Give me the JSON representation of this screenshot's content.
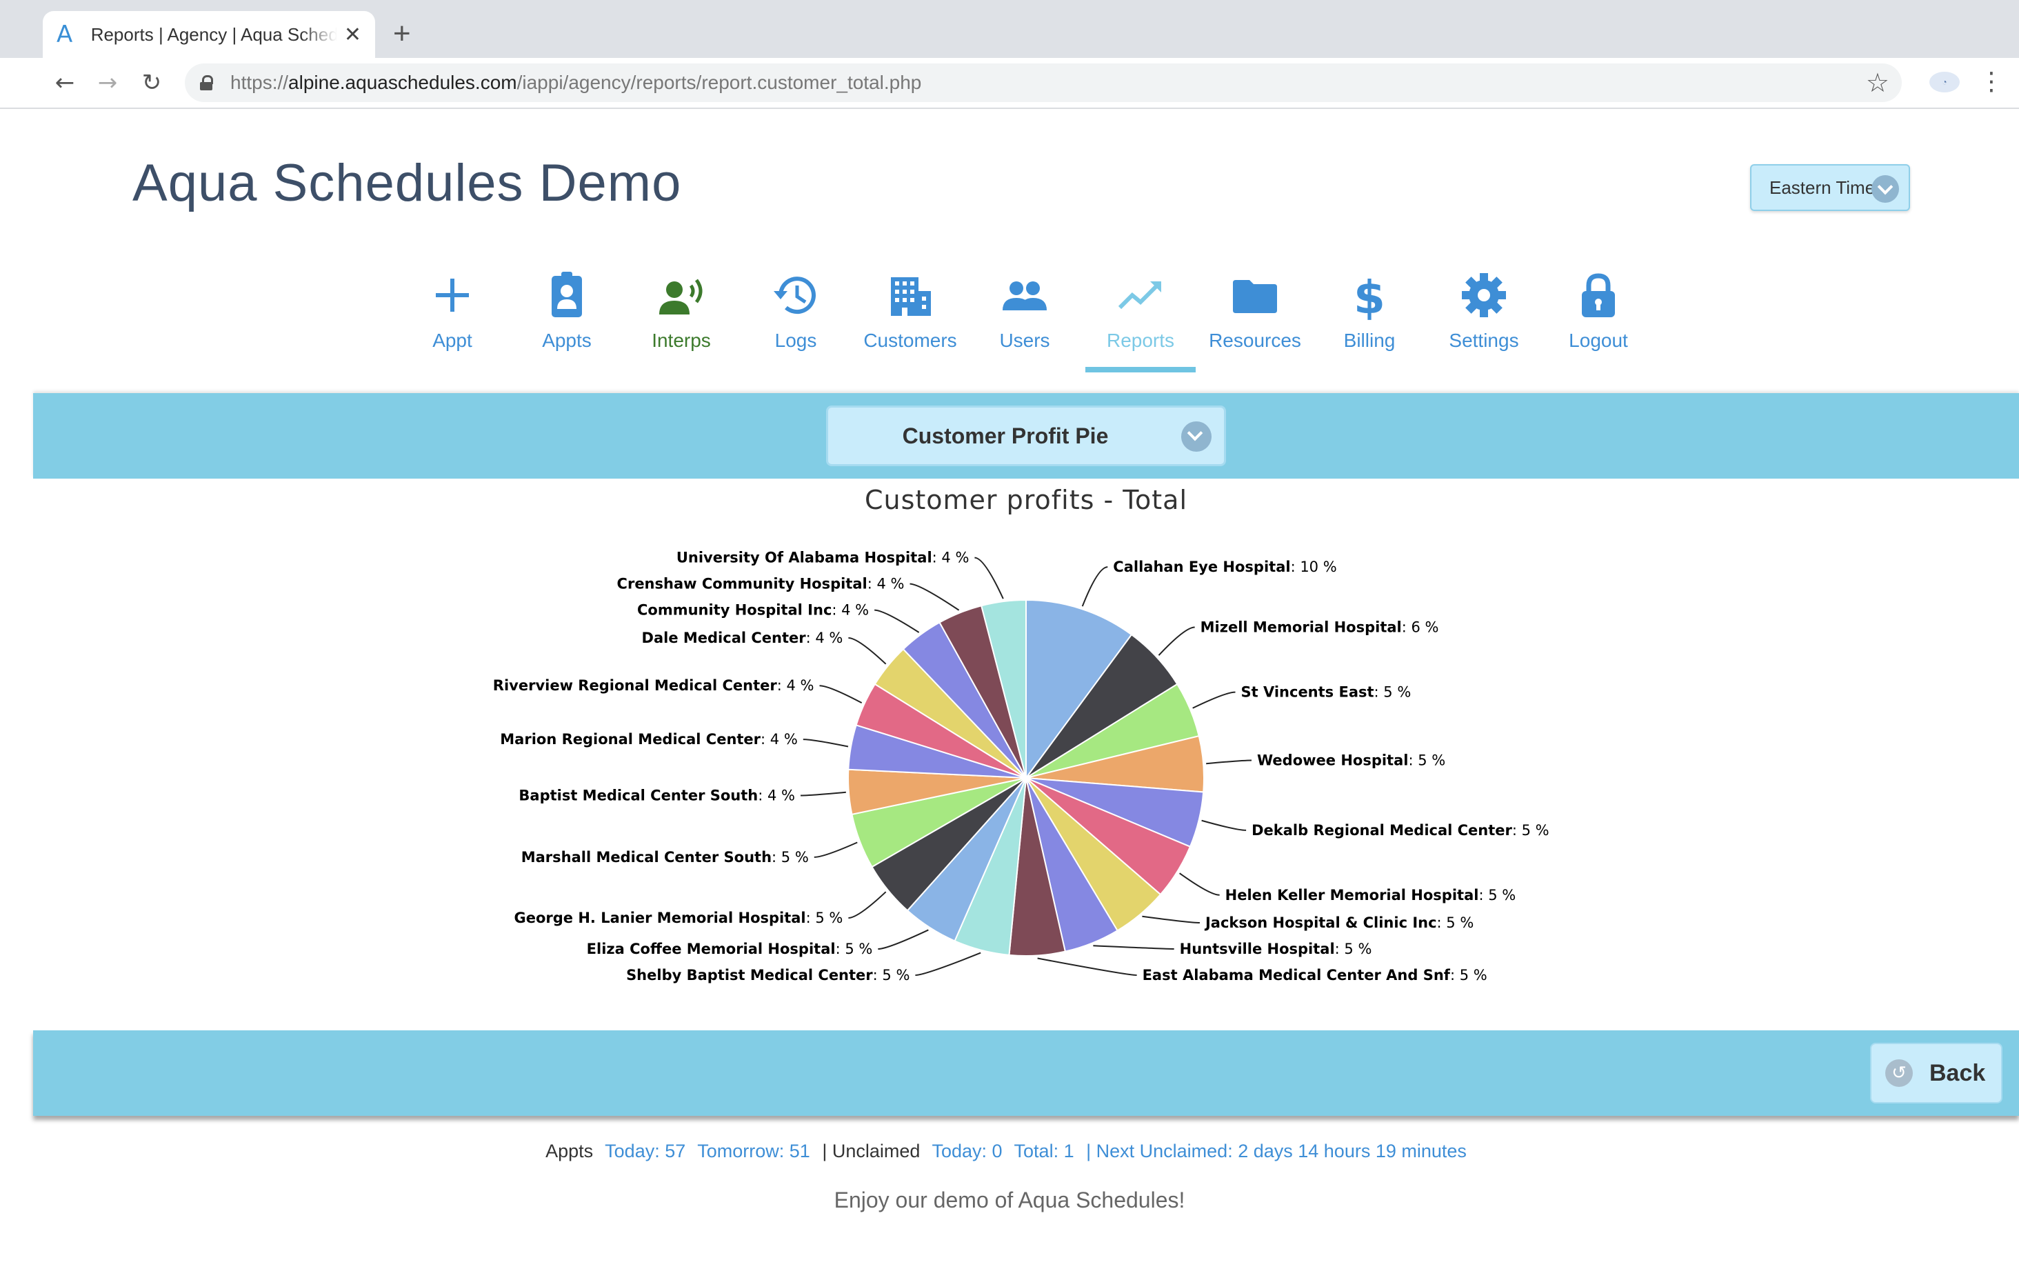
{
  "browser": {
    "tab_title": "Reports | Agency | Aqua Schedules",
    "tab_favicon": "A",
    "url_prefix": "https://",
    "url_host": "alpine.aquaschedules.com",
    "url_path": "/iappi/agency/reports/report.customer_total.php",
    "icons": [
      "back-arrow-icon",
      "forward-arrow-icon",
      "reload-icon",
      "lock-icon",
      "star-icon",
      "extension-icon",
      "menu-icon"
    ]
  },
  "header": {
    "title": "Aqua Schedules Demo",
    "timezone": "Eastern Time"
  },
  "nav": [
    {
      "label": "Appt",
      "icon": "plus-icon"
    },
    {
      "label": "Appts",
      "icon": "id-badge-icon"
    },
    {
      "label": "Interps",
      "icon": "interpreter-icon"
    },
    {
      "label": "Logs",
      "icon": "history-icon"
    },
    {
      "label": "Customers",
      "icon": "building-icon"
    },
    {
      "label": "Users",
      "icon": "users-icon"
    },
    {
      "label": "Reports",
      "icon": "chart-line-icon",
      "active": true
    },
    {
      "label": "Resources",
      "icon": "folder-icon"
    },
    {
      "label": "Billing",
      "icon": "dollar-icon"
    },
    {
      "label": "Settings",
      "icon": "gear-icon"
    },
    {
      "label": "Logout",
      "icon": "lock-icon"
    }
  ],
  "colors": {
    "nav_link": "#3e8ed6",
    "nav_active": "#7cc9e6",
    "band": "#82cde5",
    "button_bg": "#c9ecfb"
  },
  "report_select": {
    "selected": "Customer Profit Pie"
  },
  "chart_data": {
    "type": "pie",
    "title": "Customer profits - Total",
    "unit": "%",
    "slices": [
      {
        "label": "Callahan Eye Hospital",
        "value": 10,
        "color": "#8ab4e6"
      },
      {
        "label": "Mizell Memorial Hospital",
        "value": 6,
        "color": "#434348"
      },
      {
        "label": "St Vincents East",
        "value": 5,
        "color": "#a6e881"
      },
      {
        "label": "Wedowee Hospital",
        "value": 5,
        "color": "#eca76a"
      },
      {
        "label": "Dekalb Regional Medical Center",
        "value": 5,
        "color": "#8588e2"
      },
      {
        "label": "Helen Keller Memorial Hospital",
        "value": 5,
        "color": "#e26986"
      },
      {
        "label": "Jackson Hospital & Clinic Inc",
        "value": 5,
        "color": "#e3d46c"
      },
      {
        "label": "Huntsville Hospital",
        "value": 5,
        "color": "#8588e2"
      },
      {
        "label": "East Alabama Medical Center And Snf",
        "value": 5,
        "color": "#7e4a56"
      },
      {
        "label": "Shelby Baptist Medical Center",
        "value": 5,
        "color": "#a4e4df"
      },
      {
        "label": "Eliza Coffee Memorial Hospital",
        "value": 5,
        "color": "#8ab4e6"
      },
      {
        "label": "George H. Lanier Memorial Hospital",
        "value": 5,
        "color": "#434348"
      },
      {
        "label": "Marshall Medical Center South",
        "value": 5,
        "color": "#a6e881"
      },
      {
        "label": "Baptist Medical Center South",
        "value": 4,
        "color": "#eca76a"
      },
      {
        "label": "Marion Regional Medical Center",
        "value": 4,
        "color": "#8588e2"
      },
      {
        "label": "Riverview Regional Medical Center",
        "value": 4,
        "color": "#e26986"
      },
      {
        "label": "Dale Medical Center",
        "value": 4,
        "color": "#e3d46c"
      },
      {
        "label": "Community Hospital Inc",
        "value": 4,
        "color": "#8588e2"
      },
      {
        "label": "Crenshaw Community Hospital",
        "value": 4,
        "color": "#7e4a56"
      },
      {
        "label": "University Of Alabama Hospital",
        "value": 4,
        "color": "#a4e4df"
      }
    ]
  },
  "back_button": {
    "label": "Back"
  },
  "stats": {
    "appts_label": "Appts",
    "today": "Today: 57",
    "tomorrow": "Tomorrow: 51",
    "unclaimed_label": "| Unclaimed",
    "unclaimed_today": "Today: 0",
    "unclaimed_total": "Total: 1",
    "next_unclaimed": "| Next Unclaimed: 2 days 14 hours 19 minutes"
  },
  "tagline": "Enjoy our demo of Aqua Schedules!"
}
